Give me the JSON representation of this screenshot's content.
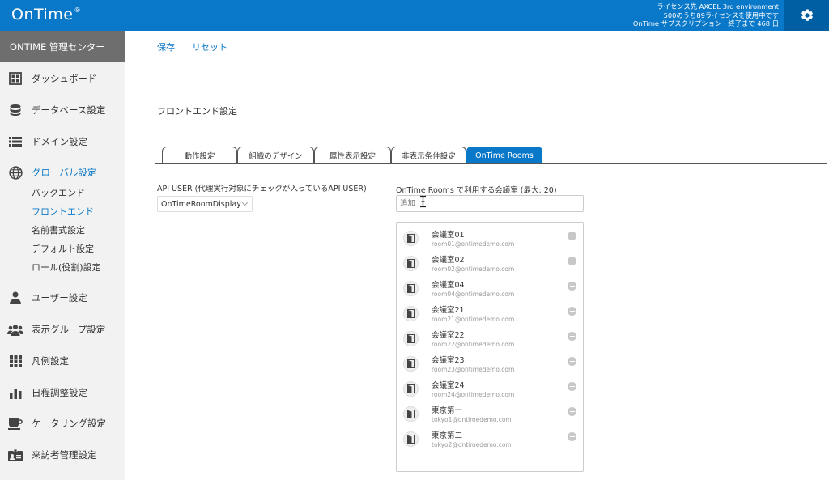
{
  "header": {
    "logo": "OnTime",
    "logo_mark": "®",
    "license_lines": [
      "ライセンス先 AXCEL 3rd environment",
      "500のうち89ライセンスを使用中です",
      "OnTime サブスクリプション | 終了まで 468 日"
    ],
    "settings_icon": "gear-icon",
    "colors": {
      "header_bg": "#0a78c8",
      "gear_bg": "#005fa3",
      "accent": "#0a78c8"
    }
  },
  "sidebar": {
    "title": "ONTIME 管理センター",
    "items": [
      {
        "label": "ダッシュボード",
        "icon": "dashboard-grid-icon"
      },
      {
        "label": "データベース設定",
        "icon": "database-icon"
      },
      {
        "label": "ドメイン設定",
        "icon": "list-icon"
      },
      {
        "label": "グローバル設定",
        "icon": "globe-icon",
        "active": true
      },
      {
        "label": "ユーザー設定",
        "icon": "user-icon"
      },
      {
        "label": "表示グループ設定",
        "icon": "group-icon"
      },
      {
        "label": "凡例設定",
        "icon": "apps-grid-icon"
      },
      {
        "label": "日程調整設定",
        "icon": "bar-chart-icon"
      },
      {
        "label": "ケータリング設定",
        "icon": "coffee-icon"
      },
      {
        "label": "来訪者管理設定",
        "icon": "id-card-icon"
      }
    ],
    "subitems": [
      {
        "label": "バックエンド"
      },
      {
        "label": "フロントエンド",
        "active": true
      },
      {
        "label": "名前書式設定"
      },
      {
        "label": "デフォルト設定"
      },
      {
        "label": "ロール(役割)設定"
      }
    ]
  },
  "toolbar": {
    "save": "保存",
    "reset": "リセット"
  },
  "main": {
    "title": "フロントエンド設定",
    "tabs": [
      {
        "label": "動作設定"
      },
      {
        "label": "組織のデザイン"
      },
      {
        "label": "属性表示設定"
      },
      {
        "label": "非表示条件設定"
      },
      {
        "label": "OnTime Rooms",
        "active": true
      }
    ],
    "api_user_label": "API USER (代理実行対象にチェックが入っているAPI USER)",
    "api_user_value": "OnTimeRoomDisplay",
    "rooms_label": "OnTime Rooms で利用する会議室 (最大: 20)",
    "add_placeholder": "追加",
    "rooms": [
      {
        "name": "会議室01",
        "email": "room01@ontimedemo.com"
      },
      {
        "name": "会議室02",
        "email": "room02@ontimedemo.com"
      },
      {
        "name": "会議室04",
        "email": "room04@ontimedemo.com"
      },
      {
        "name": "会議室21",
        "email": "room21@ontimedemo.com"
      },
      {
        "name": "会議室22",
        "email": "room22@ontimedemo.com"
      },
      {
        "name": "会議室23",
        "email": "room23@ontimedemo.com"
      },
      {
        "name": "会議室24",
        "email": "room24@ontimedemo.com"
      },
      {
        "name": "東京第一",
        "email": "tokyo1@ontimedemo.com"
      },
      {
        "name": "東京第二",
        "email": "tokyo2@ontimedemo.com"
      }
    ]
  }
}
